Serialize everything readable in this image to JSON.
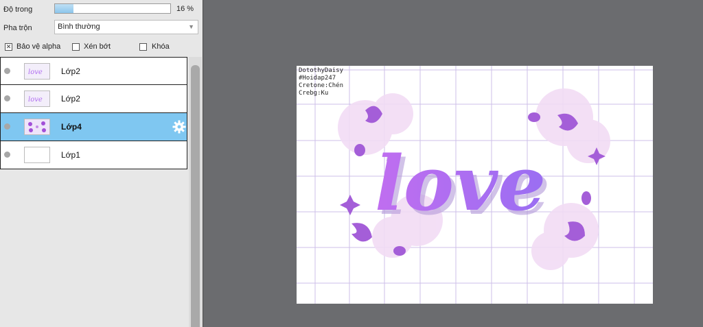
{
  "panel": {
    "opacity_label": "Độ trong",
    "opacity_value": "16 %",
    "opacity_fraction": 0.16,
    "blend_label": "Pha trộn",
    "blend_value": "Bình thường",
    "protect_alpha_label": "Bảo vệ alpha",
    "protect_alpha_checked": true,
    "clip_label": "Xén bớt",
    "lock_label": "Khóa"
  },
  "layers": [
    {
      "name": "Lớp2",
      "active": false
    },
    {
      "name": "Lớp2",
      "active": false
    },
    {
      "name": "Lớp4",
      "active": true
    },
    {
      "name": "Lớp1",
      "active": false
    }
  ],
  "canvas": {
    "credits": [
      "DotothyDaisy",
      "#Hoidap247",
      "Cretone:Chén",
      "Crebg:Ku"
    ],
    "artwork_text": "love"
  },
  "colors": {
    "active_layer": "#7fc7f1",
    "accent_purple": "#b06ef0"
  }
}
